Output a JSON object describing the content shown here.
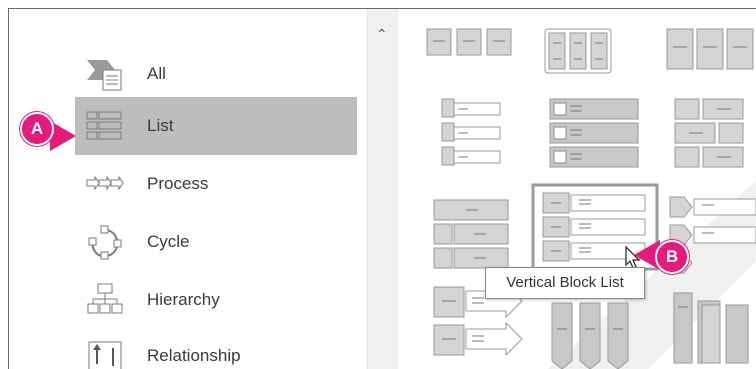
{
  "categories": [
    {
      "label": "All",
      "icon": "all-icon"
    },
    {
      "label": "List",
      "icon": "list-icon"
    },
    {
      "label": "Process",
      "icon": "process-icon"
    },
    {
      "label": "Cycle",
      "icon": "cycle-icon"
    },
    {
      "label": "Hierarchy",
      "icon": "hierarchy-icon"
    },
    {
      "label": "Relationship",
      "icon": "relationship-icon"
    }
  ],
  "selected_category": "List",
  "tooltip": "Vertical Block List",
  "callouts": {
    "a": "A",
    "b": "B"
  },
  "colors": {
    "selected": "#bdbdbd",
    "badge": "#e6197c",
    "shape": "#bfbfbf"
  }
}
